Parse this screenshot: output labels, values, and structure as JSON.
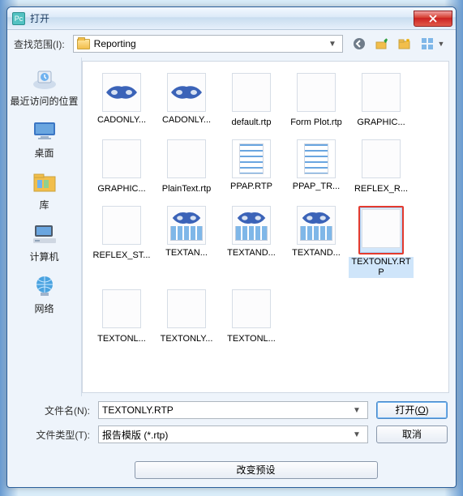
{
  "title": "打开",
  "lookin_label": "查找范围(I):",
  "lookin_value": "Reporting",
  "places": [
    {
      "id": "recent",
      "label": "最近访问的位置"
    },
    {
      "id": "desktop",
      "label": "桌面"
    },
    {
      "id": "library",
      "label": "库"
    },
    {
      "id": "computer",
      "label": "计算机"
    },
    {
      "id": "network",
      "label": "网络"
    }
  ],
  "files": [
    {
      "name": "CADONLY...",
      "kind": "cad"
    },
    {
      "name": "CADONLY...",
      "kind": "cad"
    },
    {
      "name": "default.rtp",
      "kind": "blank"
    },
    {
      "name": "Form Plot.rtp",
      "kind": "blank"
    },
    {
      "name": "GRAPHIC...",
      "kind": "blank"
    },
    {
      "name": "GRAPHIC...",
      "kind": "blank"
    },
    {
      "name": "PlainText.rtp",
      "kind": "blank"
    },
    {
      "name": "PPAP.RTP",
      "kind": "report"
    },
    {
      "name": "PPAP_TR...",
      "kind": "report"
    },
    {
      "name": "REFLEX_R...",
      "kind": "blank"
    },
    {
      "name": "REFLEX_ST...",
      "kind": "blank"
    },
    {
      "name": "TEXTAN...",
      "kind": "mix"
    },
    {
      "name": "TEXTAND...",
      "kind": "mix"
    },
    {
      "name": "TEXTAND...",
      "kind": "mix"
    },
    {
      "name": "TEXTONLY.RTP",
      "kind": "blank",
      "selected": true
    },
    {
      "name": "TEXTONL...",
      "kind": "blank"
    },
    {
      "name": "TEXTONLY...",
      "kind": "blank"
    },
    {
      "name": "TEXTONL...",
      "kind": "blank"
    }
  ],
  "filename_label": "文件名(N):",
  "filename_value": "TEXTONLY.RTP",
  "filetype_label": "文件类型(T):",
  "filetype_value": "报告模版 (*.rtp)",
  "open_btn": "打开(O)",
  "cancel_btn": "取消",
  "change_btn": "改变预设"
}
